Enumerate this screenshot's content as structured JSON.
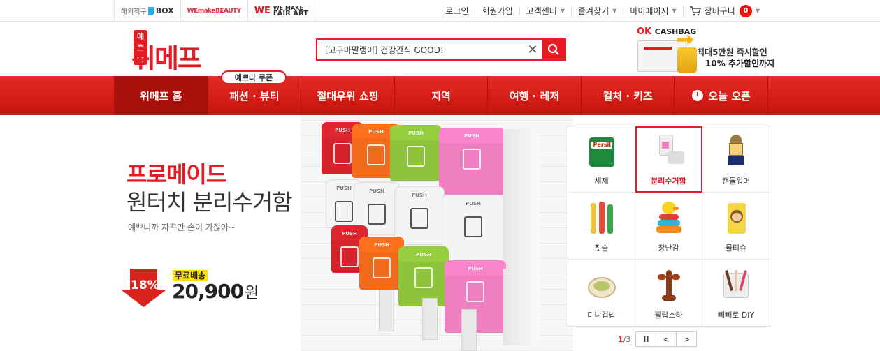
{
  "topbar": {
    "links": [
      {
        "prefix": "해외직구",
        "label": "BOX"
      },
      {
        "label": "WEmakeBEAUTY"
      },
      {
        "logo": "WE",
        "line1": "WE MAKE",
        "line2": "FAIR ART"
      }
    ],
    "right": {
      "login": "로그인",
      "signup": "회원가입",
      "support": "고객센터",
      "favorites": "즐겨찾기",
      "mypage": "마이페이지",
      "cart": "장바구니",
      "cart_count": "0"
    }
  },
  "header": {
    "logo_tag": "예쁘다",
    "logo": "위메프",
    "search_value": "[고구마말랭이] 건강간식 GOOD!",
    "ok_cashbag": {
      "ok": "OK",
      "cashbag": "CASHBAG",
      "line1": "최대5만원 즉시할인",
      "line2": "10% 추가할인까지"
    }
  },
  "nav": {
    "coupon": "예쁘다 쿠폰",
    "items": [
      "위메프 홈",
      "패션 · 뷰티",
      "절대우위 쇼핑",
      "지역",
      "여행 · 레저",
      "컬처 · 키즈",
      "오늘 오픈"
    ]
  },
  "banner": {
    "title1": "프로메이드",
    "title2": "원터치 분리수거함",
    "subtitle": "예쁘니까 자꾸만 손이 가잖아~",
    "discount": "18%",
    "free_shipping": "무료배송",
    "price": "20,900",
    "currency": "원",
    "bin_labels": [
      "PUSH",
      "PUSH",
      "PUSH",
      "PUSH",
      "PUSH",
      "PUSH",
      "PUSH",
      "PUSH",
      "PUSH",
      "PUSH",
      "PUSH",
      "PUSH"
    ]
  },
  "categories": [
    {
      "label": "세제",
      "icon": "detergent-icon"
    },
    {
      "label": "분리수거함",
      "icon": "recycle-bin-icon"
    },
    {
      "label": "캔들워머",
      "icon": "candle-warmer-icon"
    },
    {
      "label": "칫솔",
      "icon": "toothbrush-icon"
    },
    {
      "label": "장난감",
      "icon": "toy-duck-icon"
    },
    {
      "label": "물티슈",
      "icon": "wet-tissue-icon"
    },
    {
      "label": "미니컵밥",
      "icon": "cup-rice-icon"
    },
    {
      "label": "꽐랍스타",
      "icon": "lobster-icon"
    },
    {
      "label": "빼빼로 DIY",
      "icon": "pepero-icon"
    }
  ],
  "pager": {
    "current": "1",
    "total": "/3",
    "pause": "II",
    "prev": "<",
    "next": ">"
  },
  "colors": {
    "brand_red": "#e51c23",
    "nav_red": "#d41e16",
    "badge_yellow": "#ffe000"
  }
}
